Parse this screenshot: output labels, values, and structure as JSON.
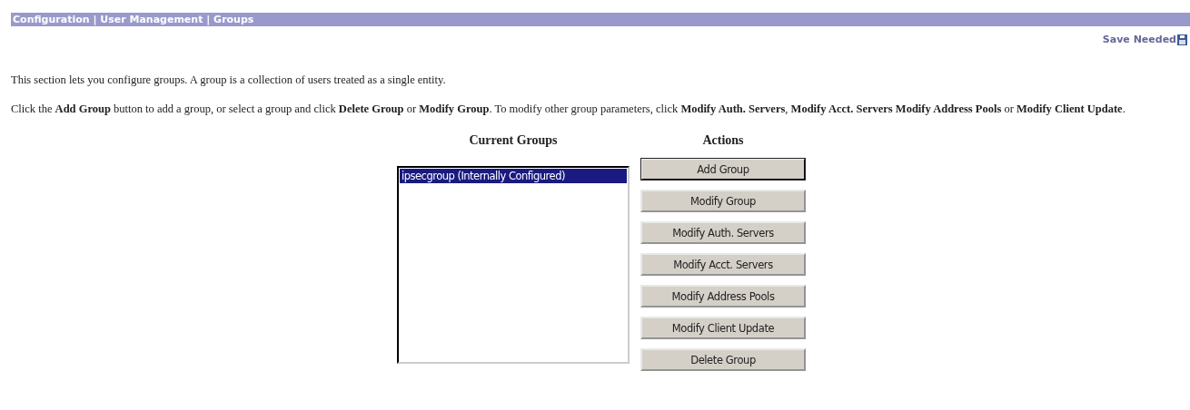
{
  "breadcrumb": "Configuration | User Management | Groups",
  "save_needed": "Save Needed",
  "paragraphs": [
    "This section lets you configure groups. A group is a collection of users treated as a single entity.",
    "Click the **Add Group** button to add a group, or select a group and click **Delete Group** or **Modify Group**. To modify other group parameters, click **Modify Auth. Servers**, **Modify Acct. Servers** **Modify Address Pools** or **Modify Client Update**."
  ],
  "groups": {
    "heading": "Current Groups",
    "items": [
      {
        "label": "ipsecgroup (Internally Configured)",
        "selected": true
      }
    ]
  },
  "actions": {
    "heading": "Actions",
    "buttons": [
      {
        "label": "Add Group",
        "focused": true
      },
      {
        "label": "Modify Group",
        "focused": false
      },
      {
        "label": "Modify Auth. Servers",
        "focused": false
      },
      {
        "label": "Modify Acct. Servers",
        "focused": false
      },
      {
        "label": "Modify Address Pools",
        "focused": false
      },
      {
        "label": "Modify Client Update",
        "focused": false
      },
      {
        "label": "Delete Group",
        "focused": false
      }
    ]
  }
}
